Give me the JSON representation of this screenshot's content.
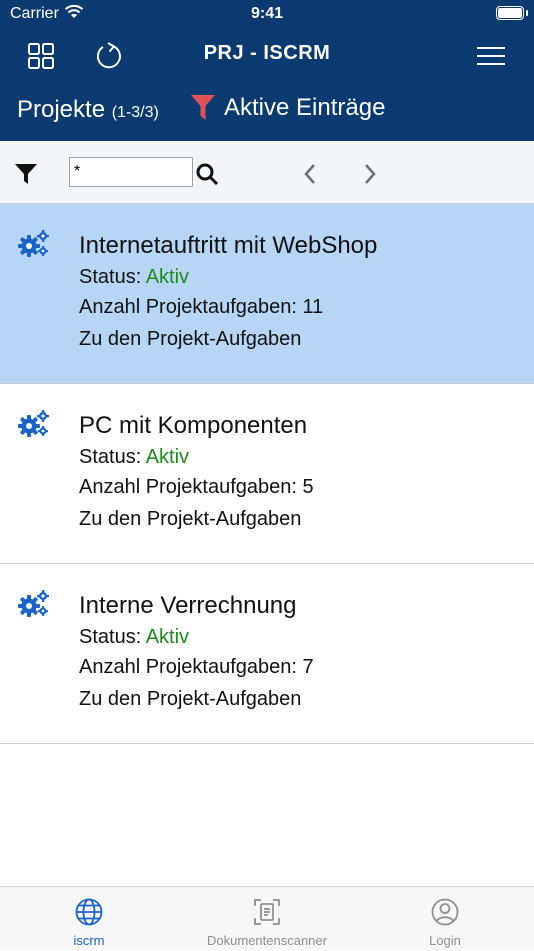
{
  "status_bar": {
    "carrier": "Carrier",
    "time": "9:41"
  },
  "nav": {
    "title": "PRJ - ISCRM"
  },
  "sub_header": {
    "title": "Projekte",
    "count": "(1-3/3)",
    "filter_label": "Aktive Einträge"
  },
  "toolbar": {
    "search_value": "*"
  },
  "projects": [
    {
      "name": "Internetauftritt mit WebShop",
      "status_label": "Status:",
      "status_value": "Aktiv",
      "count_label": "Anzahl Projektaufgaben: 11",
      "link": "Zu den Projekt-Aufgaben",
      "selected": true
    },
    {
      "name": "PC mit Komponenten",
      "status_label": "Status:",
      "status_value": "Aktiv",
      "count_label": "Anzahl Projektaufgaben: 5",
      "link": "Zu den Projekt-Aufgaben",
      "selected": false
    },
    {
      "name": "Interne Verrechnung",
      "status_label": "Status:",
      "status_value": "Aktiv",
      "count_label": "Anzahl Projektaufgaben: 7",
      "link": "Zu den Projekt-Aufgaben",
      "selected": false
    }
  ],
  "tabs": [
    {
      "label": "iscrm",
      "icon": "globe-icon",
      "active": true
    },
    {
      "label": "Dokumentenscanner",
      "icon": "document-scanner-icon",
      "active": false
    },
    {
      "label": "Login",
      "icon": "user-circle-icon",
      "active": false
    }
  ],
  "colors": {
    "header": "#0b3a70",
    "selected_row": "#b7d6f6",
    "status_active": "#1c8a1c",
    "accent": "#1a63c9",
    "filter_funnel": "#e0525a"
  }
}
